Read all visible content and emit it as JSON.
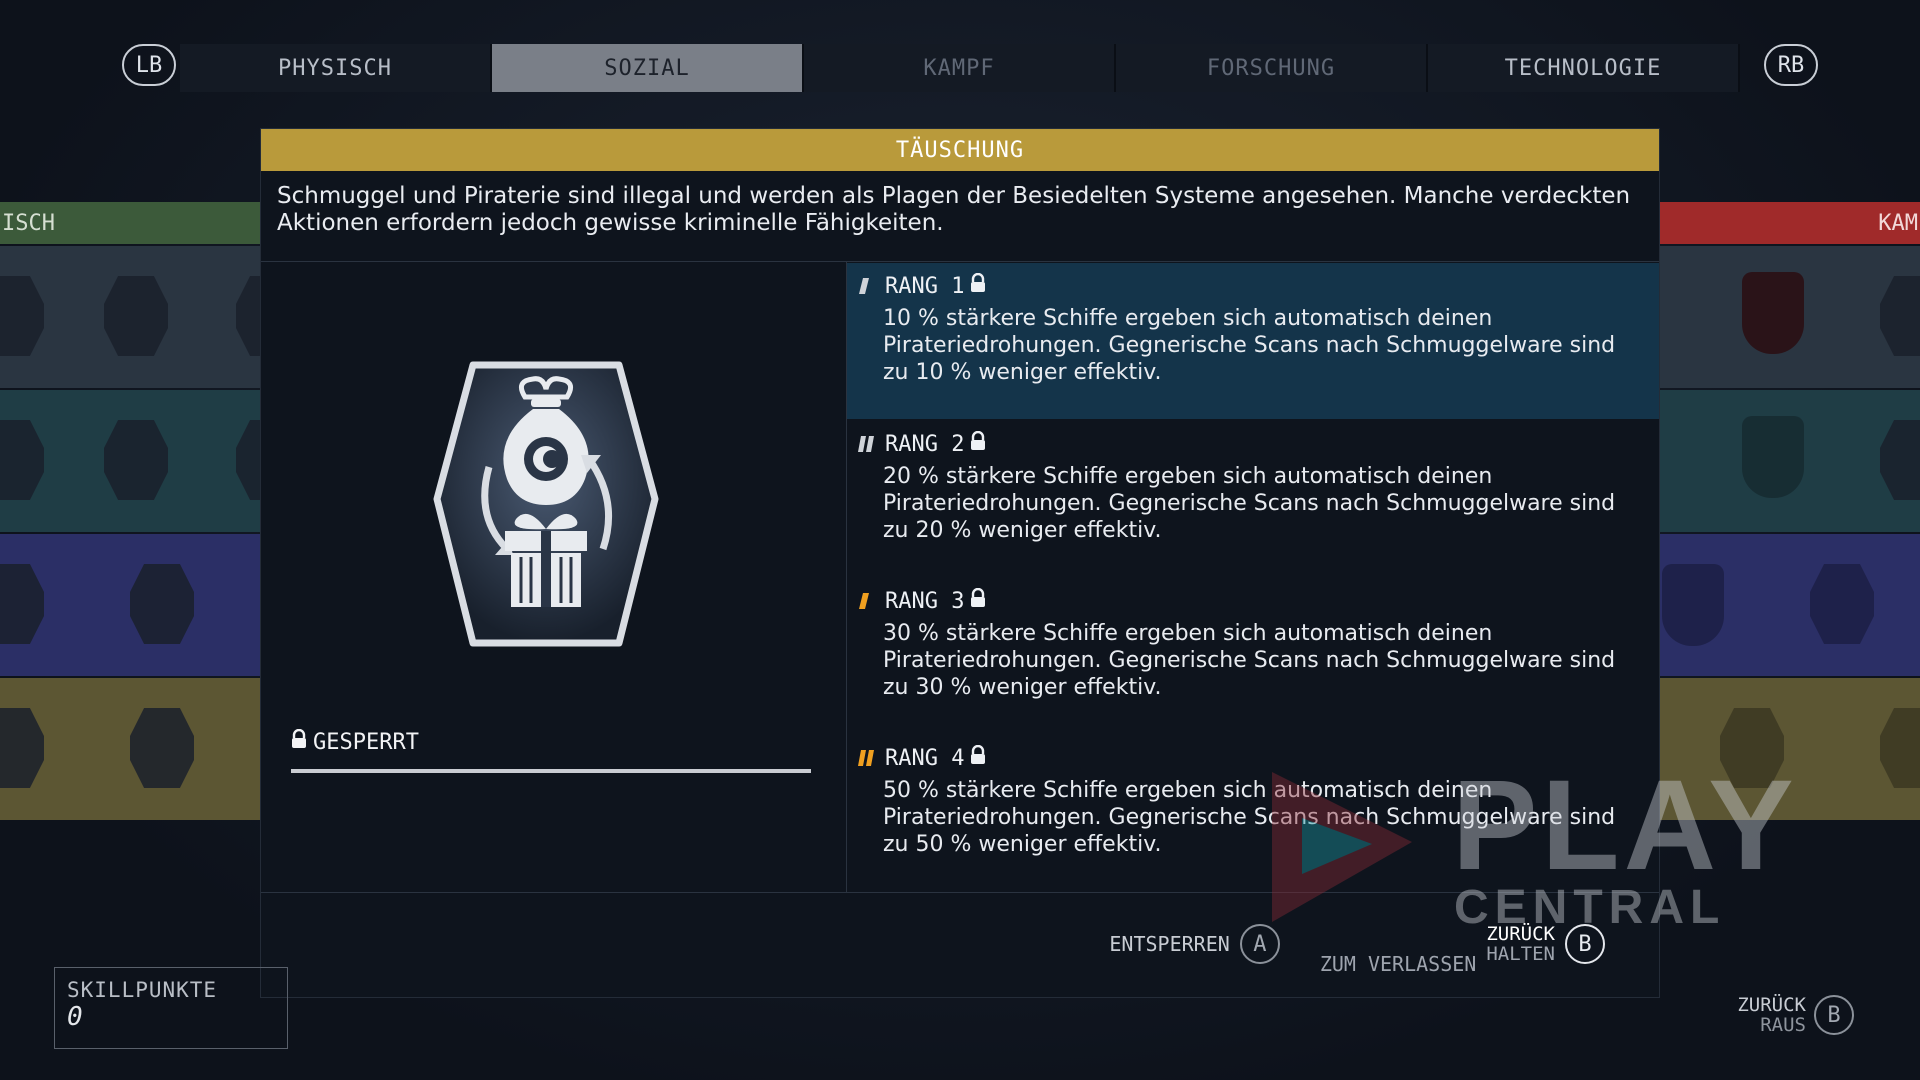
{
  "tabs": {
    "lb": "LB",
    "rb": "RB",
    "items": [
      {
        "label": "PHYSISCH"
      },
      {
        "label": "SOZIAL"
      },
      {
        "label": "KAMPF"
      },
      {
        "label": "FORSCHUNG"
      },
      {
        "label": "TECHNOLOGIE"
      }
    ]
  },
  "side": {
    "left_header": "ISCH",
    "right_header": "KAM"
  },
  "skill": {
    "title": "TÄUSCHUNG",
    "description": "Schmuggel und Piraterie sind illegal und werden als Plagen der Besiedelten Systeme angesehen. Manche verdeckten Aktionen erfordern jedoch gewisse kriminelle Fähigkeiten.",
    "status": "GESPERRT",
    "icon": "smuggled-bag-and-gift-icon",
    "ranks": [
      {
        "label": "RANG 1",
        "text": "10 % stärkere Schiffe ergeben sich automatisch deinen Pirateriedrohungen. Gegnerische Scans nach Schmuggelware sind zu 10 % weniger effektiv."
      },
      {
        "label": "RANG 2",
        "text": "20 % stärkere Schiffe ergeben sich automatisch deinen Pirateriedrohungen. Gegnerische Scans nach Schmuggelware sind zu 20 % weniger effektiv."
      },
      {
        "label": "RANG 3",
        "text": "30 % stärkere Schiffe ergeben sich automatisch deinen Pirateriedrohungen. Gegnerische Scans nach Schmuggelware sind zu 30 % weniger effektiv."
      },
      {
        "label": "RANG 4",
        "text": "50 % stärkere Schiffe ergeben sich automatisch deinen Pirateriedrohungen. Gegnerische Scans nach Schmuggelware sind zu 50 % weniger effektiv."
      }
    ]
  },
  "actions": {
    "unlock_label": "ENTSPERREN",
    "unlock_button": "A",
    "hold_label": "ZUM VERLASSEN",
    "back_top": "ZURÜCK",
    "back_bottom": "HALTEN",
    "back_button": "B",
    "exit_top": "ZURÜCK",
    "exit_bottom": "RAUS",
    "exit_button": "B"
  },
  "skillpoints": {
    "label": "SKILLPUNKTE",
    "value": "0"
  },
  "watermark": {
    "main": "PLAY",
    "sub": "CENTRAL"
  },
  "colors": {
    "title_bar": "#b99a3b",
    "selected_rank": "#14344a",
    "tick_rank1": "#cfd3d9",
    "tick_rank2": "#cfd3d9",
    "tick_rank3": "#f0a020",
    "tick_rank4": "#f0a020"
  }
}
